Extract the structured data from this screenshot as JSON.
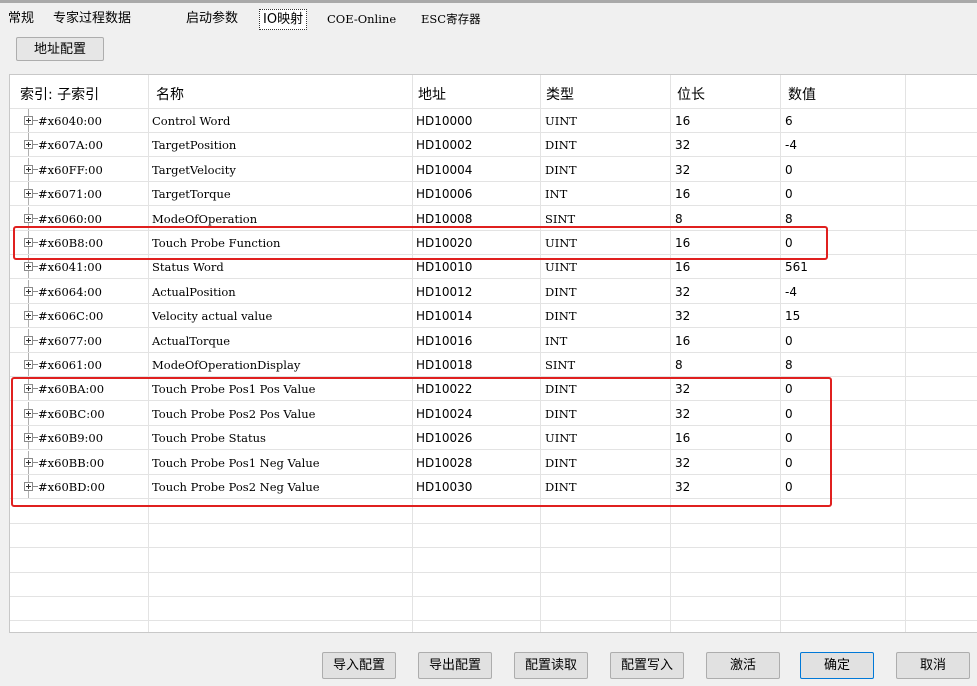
{
  "tabs": [
    {
      "label": "常规"
    },
    {
      "label": "专家过程数据"
    },
    {
      "label": "启动参数"
    },
    {
      "label": "IO映射"
    },
    {
      "label": "COE-Online"
    },
    {
      "label": "ESC寄存器"
    }
  ],
  "active_tab": "IO映射",
  "address_config_button": "地址配置",
  "table": {
    "columns": [
      "索引: 子索引",
      "名称",
      "地址",
      "类型",
      "位长",
      "数值"
    ],
    "rows": [
      {
        "index": "#x6040:00",
        "name": "Control Word",
        "address": "HD10000",
        "type": "UINT",
        "bits": "16",
        "value": "6"
      },
      {
        "index": "#x607A:00",
        "name": "TargetPosition",
        "address": "HD10002",
        "type": "DINT",
        "bits": "32",
        "value": "-4"
      },
      {
        "index": "#x60FF:00",
        "name": "TargetVelocity",
        "address": "HD10004",
        "type": "DINT",
        "bits": "32",
        "value": "0"
      },
      {
        "index": "#x6071:00",
        "name": "TargetTorque",
        "address": "HD10006",
        "type": "INT",
        "bits": "16",
        "value": "0"
      },
      {
        "index": "#x6060:00",
        "name": "ModeOfOperation",
        "address": "HD10008",
        "type": "SINT",
        "bits": "8",
        "value": "8"
      },
      {
        "index": "#x60B8:00",
        "name": "Touch Probe Function",
        "address": "HD10020",
        "type": "UINT",
        "bits": "16",
        "value": "0"
      },
      {
        "index": "#x6041:00",
        "name": "Status Word",
        "address": "HD10010",
        "type": "UINT",
        "bits": "16",
        "value": "561"
      },
      {
        "index": "#x6064:00",
        "name": "ActualPosition",
        "address": "HD10012",
        "type": "DINT",
        "bits": "32",
        "value": "-4"
      },
      {
        "index": "#x606C:00",
        "name": "Velocity actual value",
        "address": "HD10014",
        "type": "DINT",
        "bits": "32",
        "value": "15"
      },
      {
        "index": "#x6077:00",
        "name": "ActualTorque",
        "address": "HD10016",
        "type": "INT",
        "bits": "16",
        "value": "0"
      },
      {
        "index": "#x6061:00",
        "name": "ModeOfOperationDisplay",
        "address": "HD10018",
        "type": "SINT",
        "bits": "8",
        "value": "8"
      },
      {
        "index": "#x60BA:00",
        "name": "Touch Probe Pos1 Pos Value",
        "address": "HD10022",
        "type": "DINT",
        "bits": "32",
        "value": "0"
      },
      {
        "index": "#x60BC:00",
        "name": "Touch Probe Pos2 Pos Value",
        "address": "HD10024",
        "type": "DINT",
        "bits": "32",
        "value": "0"
      },
      {
        "index": "#x60B9:00",
        "name": "Touch Probe Status",
        "address": "HD10026",
        "type": "UINT",
        "bits": "16",
        "value": "0"
      },
      {
        "index": "#x60BB:00",
        "name": "Touch Probe Pos1 Neg Value",
        "address": "HD10028",
        "type": "DINT",
        "bits": "32",
        "value": "0"
      },
      {
        "index": "#x60BD:00",
        "name": "Touch Probe Pos2 Neg Value",
        "address": "HD10030",
        "type": "DINT",
        "bits": "32",
        "value": "0"
      }
    ]
  },
  "buttons": {
    "import_config": "导入配置",
    "export_config": "导出配置",
    "read_config": "配置读取",
    "write_config": "配置写入",
    "activate": "激活",
    "ok": "确定",
    "cancel": "取消"
  },
  "colors": {
    "highlight": "#e0201f",
    "primary_border": "#0078d7"
  }
}
